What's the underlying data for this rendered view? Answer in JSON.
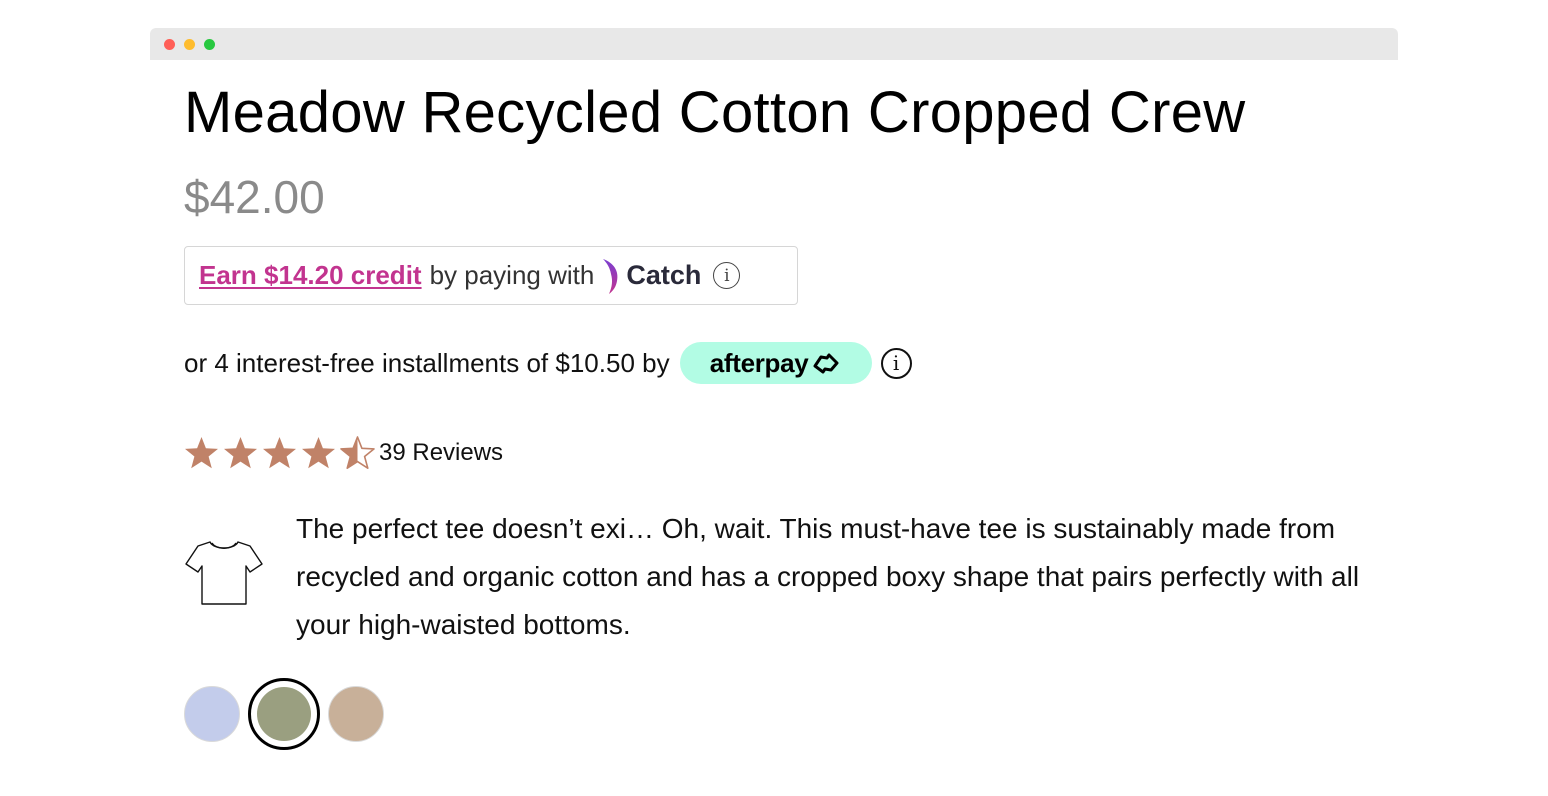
{
  "product": {
    "title": "Meadow Recycled Cotton Cropped Crew",
    "price": "$42.00"
  },
  "catch": {
    "earn_text": "Earn $14.20 credit",
    "mid_text": "by paying with",
    "brand": "Catch",
    "info_glyph": "i",
    "accent_color": "#c2348f"
  },
  "afterpay": {
    "text": "or 4 interest-free installments of $10.50 by",
    "brand": "afterpay",
    "info_glyph": "i",
    "badge_color": "#b2fce4"
  },
  "rating": {
    "value": 4.5,
    "max": 5,
    "reviews_label": "39 Reviews",
    "star_color": "#c08268"
  },
  "description": {
    "icon": "t-shirt-icon",
    "text": "The perfect tee doesn’t exi… Oh, wait. This must-have tee is sustainably made from recycled and organic cotton and has a cropped boxy shape that pairs perfectly with all your high-waisted bottoms."
  },
  "swatches": [
    {
      "color": "#c3cceb",
      "selected": false
    },
    {
      "color": "#9a9f80",
      "selected": true
    },
    {
      "color": "#c8b099",
      "selected": false
    }
  ]
}
